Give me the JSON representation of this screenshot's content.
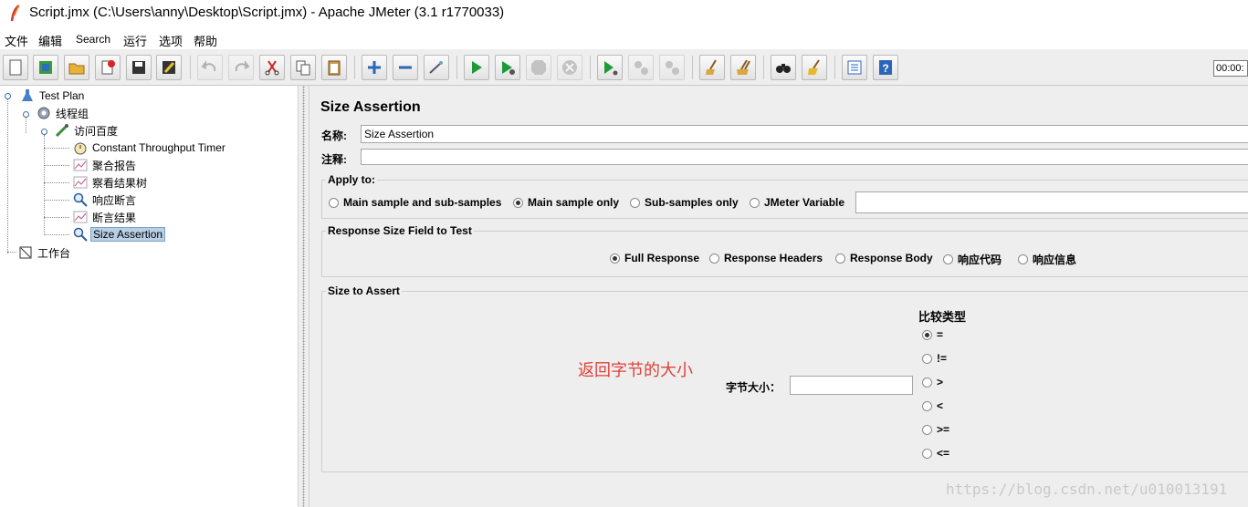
{
  "window": {
    "title": "Script.jmx (C:\\Users\\anny\\Desktop\\Script.jmx) - Apache JMeter (3.1 r1770033)"
  },
  "menu": [
    "文件",
    "编辑",
    "Search",
    "运行",
    "选项",
    "帮助"
  ],
  "toolbar": {
    "timer": "00:00:"
  },
  "tree": {
    "test_plan": "Test Plan",
    "thread_group": "线程组",
    "sampler": "访问百度",
    "children": [
      "Constant Throughput Timer",
      "聚合报告",
      "察看结果树",
      "响应断言",
      "断言结果",
      "Size Assertion"
    ],
    "workbench": "工作台"
  },
  "panel": {
    "title": "Size Assertion",
    "name_label": "名称:",
    "name_value": "Size Assertion",
    "comment_label": "注释:",
    "comment_value": "",
    "apply_to": {
      "legend": "Apply to:",
      "options": [
        "Main sample and sub-samples",
        "Main sample only",
        "Sub-samples only",
        "JMeter Variable"
      ],
      "selected": "Main sample only",
      "variable_value": ""
    },
    "response_field": {
      "legend": "Response Size Field to Test",
      "options": [
        "Full Response",
        "Response Headers",
        "Response Body",
        "响应代码",
        "响应信息"
      ],
      "selected": "Full Response"
    },
    "size_assert": {
      "legend": "Size to Assert",
      "size_label": "字节大小：",
      "size_value": "",
      "compare_label": "比较类型",
      "operators": [
        "=",
        "!=",
        ">",
        "<",
        ">=",
        "<="
      ],
      "selected": "=",
      "annotation": "返回字节的大小",
      "annotation_color": "#e0413a"
    }
  },
  "watermark": "https://blog.csdn.net/u010013191"
}
